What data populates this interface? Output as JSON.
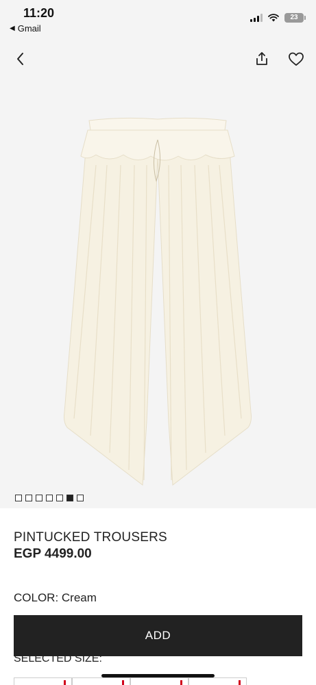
{
  "status_bar": {
    "time": "11:20",
    "back_app": "Gmail",
    "battery": "23"
  },
  "icons": {
    "back": "chevron-left-icon",
    "share": "share-icon",
    "favorite": "heart-icon"
  },
  "gallery": {
    "image_count": 7,
    "active_index": 6
  },
  "product": {
    "name": "PINTUCKED TROUSERS",
    "price": "EGP 4499.00",
    "color_label": "COLOR:",
    "color_value": "Cream",
    "color_text": "COLOR: Cream"
  },
  "actions": {
    "add_label": "ADD"
  },
  "size": {
    "label": "SELECTED SIZE:"
  },
  "colors": {
    "background": "#f4f4f4",
    "button": "#222222",
    "accent_red": "#d0021b",
    "garment": "#f7f2e4"
  }
}
